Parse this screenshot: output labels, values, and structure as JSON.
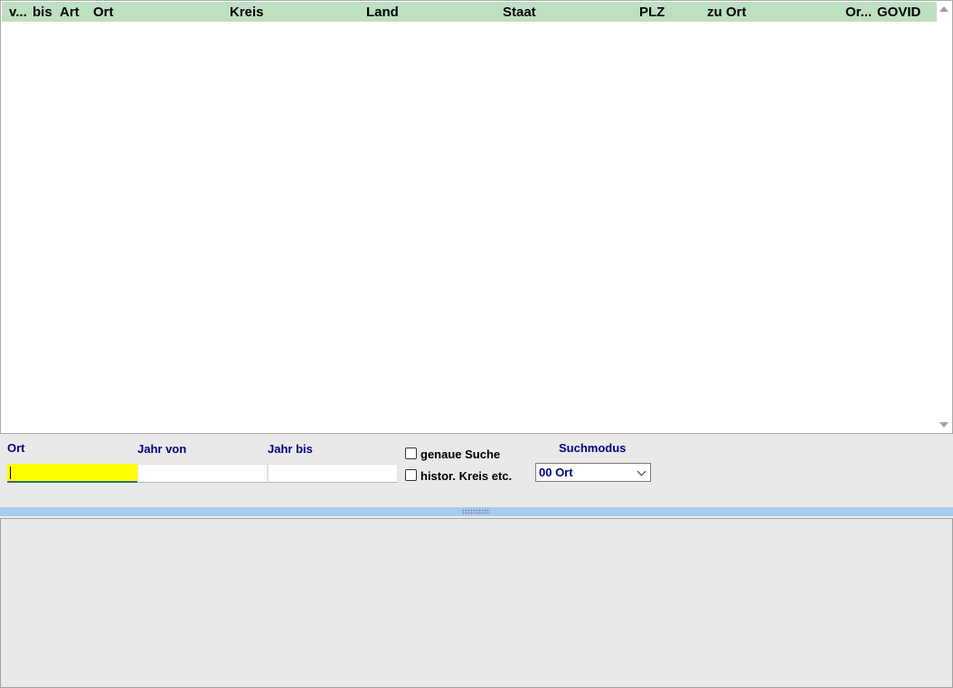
{
  "results_grid": {
    "columns": [
      "v...",
      "bis",
      "Art",
      "Ort",
      "Kreis",
      "Land",
      "Staat",
      "PLZ",
      "zu Ort",
      "Or...",
      "GOVID"
    ],
    "rows": []
  },
  "search": {
    "ort_label": "Ort",
    "ort_value": "",
    "jahr_von_label": "Jahr von",
    "jahr_von_value": "",
    "jahr_bis_label": "Jahr bis",
    "jahr_bis_value": "",
    "genaue_suche_label": "genaue Suche",
    "genaue_suche_checked": false,
    "histor_kreis_label": "histor. Kreis etc.",
    "histor_kreis_checked": false,
    "suchmodus_label": "Suchmodus",
    "suchmodus_value": "00 Ort"
  },
  "colors": {
    "header_bg": "#bfdfc1",
    "label_color": "#000080",
    "active_field_bg": "#ffff00",
    "splitter": "#a9cbee"
  },
  "icons": [
    "scroll-up-arrow-icon",
    "scroll-down-arrow-icon",
    "chevron-down-icon",
    "splitter-grip-icon"
  ]
}
